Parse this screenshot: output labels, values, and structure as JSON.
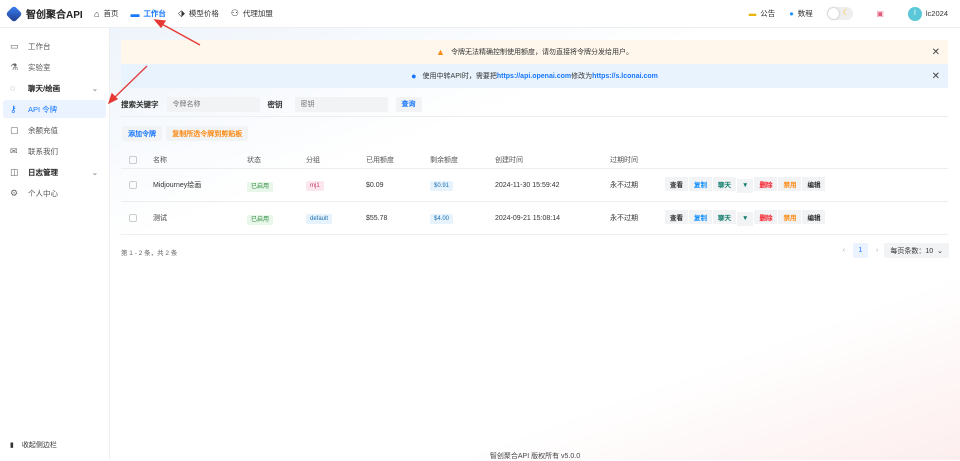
{
  "header": {
    "brand": "智创聚合API",
    "nav": [
      {
        "label": "首页",
        "icon": "home-icon"
      },
      {
        "label": "工作台",
        "icon": "dashboard-icon",
        "active": true
      },
      {
        "label": "模型价格",
        "icon": "tag-icon"
      },
      {
        "label": "代理加盟",
        "icon": "user-plus-icon"
      }
    ],
    "announcement": "公告",
    "tutorial": "数程",
    "avatar_initial": "l",
    "username": "lc2024"
  },
  "sidebar": {
    "items": [
      {
        "label": "工作台",
        "icon": "monitor-icon"
      },
      {
        "label": "实验室",
        "icon": "flask-icon"
      },
      {
        "label": "聊天/绘画",
        "icon": "chat-icon",
        "group": true
      },
      {
        "label": "API 令牌",
        "icon": "key-icon",
        "active": true
      },
      {
        "label": "余额充值",
        "icon": "wallet-icon"
      },
      {
        "label": "联系我们",
        "icon": "mail-icon"
      },
      {
        "label": "日志管理",
        "icon": "log-icon",
        "group": true
      },
      {
        "label": "个人中心",
        "icon": "settings-icon"
      }
    ],
    "collapse": "收起侧边栏"
  },
  "banners": {
    "warning": "令牌无法精确控制使用额度，请勿直接将令牌分发给用户。",
    "info_prefix": "使用中转API时，需要把",
    "info_url1": "https://api.openai.com",
    "info_mid": "修改为",
    "info_url2": "https://s.lconai.com"
  },
  "search": {
    "keyword_label": "搜索关键字",
    "keyword_placeholder": "令牌名称",
    "key_label": "密钥",
    "key_placeholder": "密钥",
    "query": "查询"
  },
  "actions": {
    "add": "添加令牌",
    "copy_selected": "复制所选令牌到剪贴板"
  },
  "table": {
    "columns": [
      "名称",
      "状态",
      "分组",
      "已用额度",
      "剩余额度",
      "创建时间",
      "过期时间"
    ],
    "rows": [
      {
        "name": "Midjourney绘画",
        "status": "已启用",
        "group": "mj1",
        "used": "$0.09",
        "remaining": "$0.91",
        "created": "2024-11-30 15:59:42",
        "expires": "永不过期"
      },
      {
        "name": "测试",
        "status": "已启用",
        "group": "default",
        "used": "$55.78",
        "remaining": "$4.00",
        "created": "2024-09-21 15:08:14",
        "expires": "永不过期"
      }
    ],
    "row_actions": {
      "view": "查看",
      "copy": "复制",
      "chat": "聊天",
      "delete": "删除",
      "disable": "禁用",
      "edit": "编辑"
    }
  },
  "pagination": {
    "summary": "第 1 - 2 条，共 2 条",
    "page": "1",
    "page_size": "每页条数：10"
  },
  "footer": "智创聚合API 版权所有 v5.0.0",
  "colors": {
    "accent": "#1677ff",
    "warning_bg": "#fff7ec",
    "info_bg": "#e9f3fe"
  }
}
